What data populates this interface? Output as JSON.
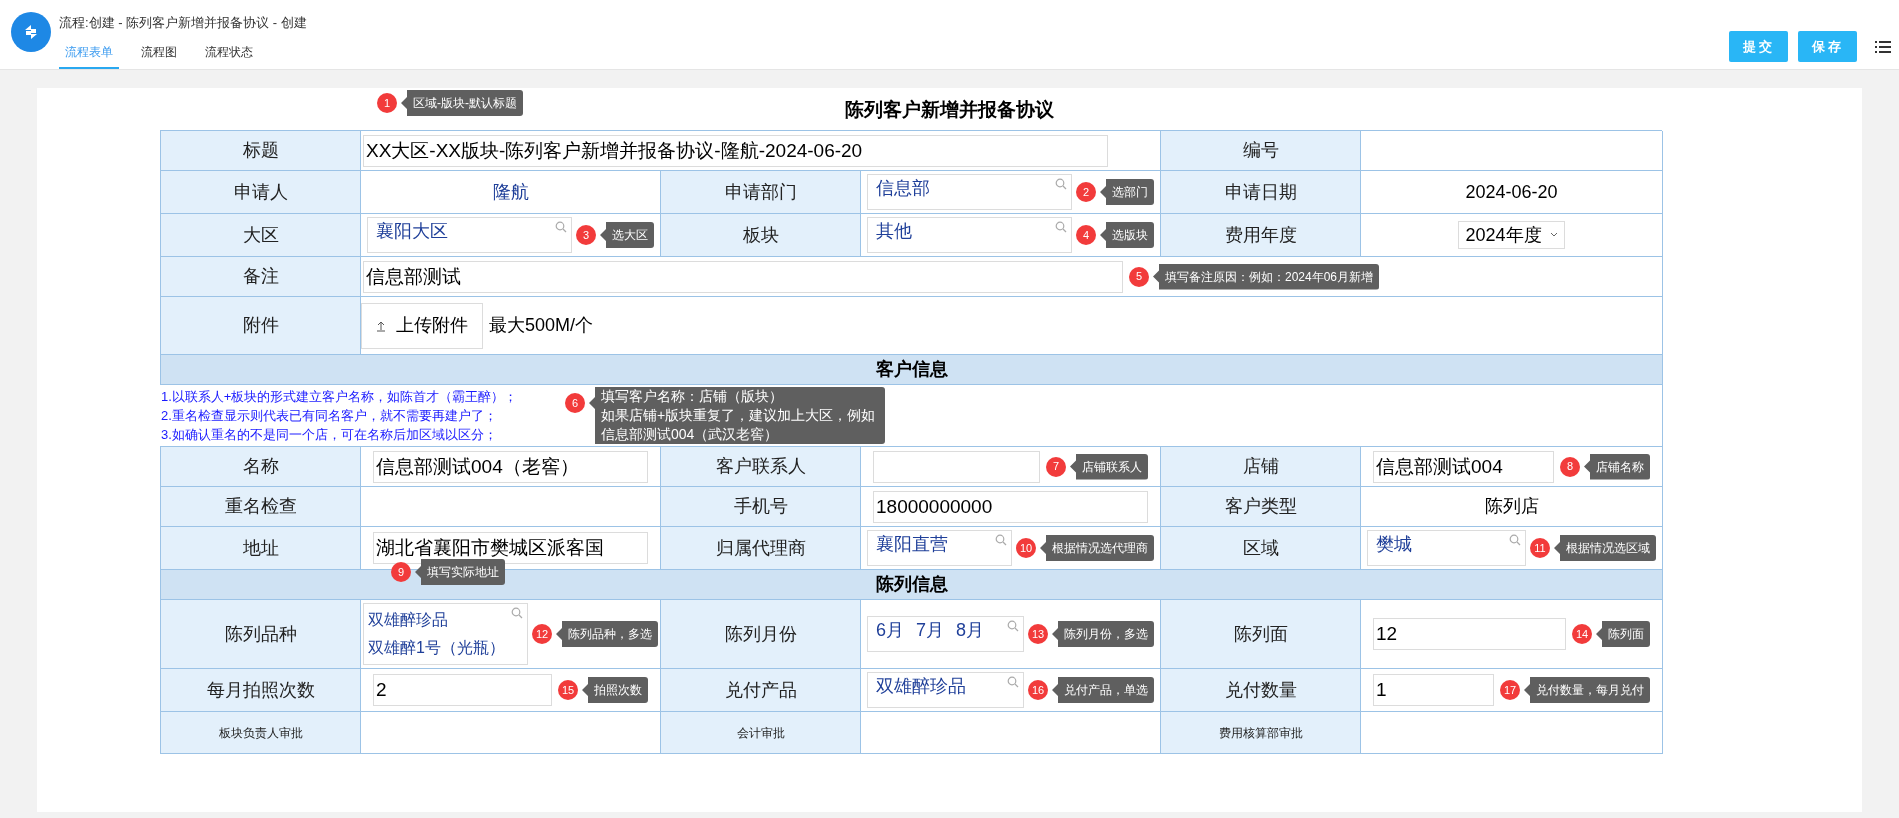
{
  "header": {
    "title": "流程:创建 - 陈列客户新增并报备协议 - 创建",
    "tabs": [
      {
        "label": "流程表单",
        "selected": true
      },
      {
        "label": "流程图",
        "selected": false
      },
      {
        "label": "流程状态",
        "selected": false
      }
    ],
    "buttons": [
      "提交",
      "保存"
    ]
  },
  "form": {
    "title": "陈列客户新增并报备协议",
    "title_hint": {
      "number": "1",
      "text": "区域-版块-默认标题"
    },
    "rows": [
      {
        "kind": "fields",
        "cells": [
          {
            "kind": "label",
            "text": "标题"
          },
          {
            "kind": "input",
            "colspan": 3,
            "value": "XX大区-XX版块-陈列客户新增并报备协议-隆航-2024-06-20"
          },
          {
            "kind": "label",
            "text": "编号"
          },
          {
            "kind": "empty"
          }
        ]
      },
      {
        "kind": "fields",
        "cells": [
          {
            "kind": "label",
            "text": "申请人"
          },
          {
            "kind": "user",
            "text": "隆航"
          },
          {
            "kind": "label",
            "text": "申请部门"
          },
          {
            "kind": "lookup",
            "values": [
              "信息部"
            ],
            "hint": {
              "number": "2",
              "text": "选部门"
            }
          },
          {
            "kind": "label",
            "text": "申请日期"
          },
          {
            "kind": "text",
            "text": "2024-06-20"
          }
        ]
      },
      {
        "kind": "fields",
        "cells": [
          {
            "kind": "label",
            "text": "大区"
          },
          {
            "kind": "lookup",
            "values": [
              "襄阳大区"
            ],
            "hint": {
              "number": "3",
              "text": "选大区"
            }
          },
          {
            "kind": "label",
            "text": "板块"
          },
          {
            "kind": "lookup",
            "values": [
              "其他"
            ],
            "hint": {
              "number": "4",
              "text": "选版块"
            }
          },
          {
            "kind": "label",
            "text": "费用年度"
          },
          {
            "kind": "select",
            "value": "2024年度"
          }
        ]
      },
      {
        "kind": "fields",
        "cells": [
          {
            "kind": "label",
            "text": "备注"
          },
          {
            "kind": "input",
            "colspan": 5,
            "value": "信息部测试",
            "hint": {
              "number": "5",
              "text": "填写备注原因：例如：2024年06月新增"
            }
          }
        ]
      },
      {
        "kind": "fields",
        "cells": [
          {
            "kind": "label",
            "text": "附件"
          },
          {
            "kind": "upload",
            "colspan": 5,
            "button": "上传附件",
            "note": "最大500M/个"
          }
        ]
      },
      {
        "kind": "section",
        "title": "客户信息"
      },
      {
        "kind": "notes",
        "lines": [
          "1.以联系人+板块的形式建立客户名称，如陈首才（霸王醉）；",
          "2.重名检查显示则代表已有同名客户，就不需要再建户了；",
          "3.如确认重名的不是同一个店，可在名称后加区域以区分；"
        ],
        "hint": {
          "number": "6",
          "lines": [
            "填写客户名称：店铺（版块）",
            "如果店铺+版块重复了，建议加上大区，例如",
            "信息部测试004（武汉老窖）"
          ]
        }
      },
      {
        "kind": "fields",
        "cells": [
          {
            "kind": "label",
            "text": "名称"
          },
          {
            "kind": "input",
            "value": "信息部测试004（老窖）"
          },
          {
            "kind": "label",
            "text": "客户联系人"
          },
          {
            "kind": "input",
            "hint": {
              "number": "7",
              "text": "店铺联系人"
            }
          },
          {
            "kind": "label",
            "text": "店铺"
          },
          {
            "kind": "input",
            "value": "信息部测试004",
            "hint": {
              "number": "8",
              "text": "店铺名称"
            }
          }
        ]
      },
      {
        "kind": "fields",
        "cells": [
          {
            "kind": "label",
            "text": "重名检查"
          },
          {
            "kind": "empty"
          },
          {
            "kind": "label",
            "text": "手机号"
          },
          {
            "kind": "input",
            "value": "18000000000"
          },
          {
            "kind": "label",
            "text": "客户类型"
          },
          {
            "kind": "text",
            "text": "陈列店"
          }
        ]
      },
      {
        "kind": "fields",
        "cells": [
          {
            "kind": "label",
            "text": "地址"
          },
          {
            "kind": "input",
            "value": "湖北省襄阳市樊城区派客国",
            "hint": {
              "number": "9",
              "text": "填写实际地址"
            }
          },
          {
            "kind": "label",
            "text": "归属代理商"
          },
          {
            "kind": "lookup",
            "values": [
              "襄阳直营"
            ],
            "hint": {
              "number": "10",
              "text": "根据情况选代理商"
            }
          },
          {
            "kind": "label",
            "text": "区域"
          },
          {
            "kind": "lookup",
            "values": [
              "樊城"
            ],
            "hint": {
              "number": "11",
              "text": "根据情况选区域"
            }
          }
        ]
      },
      {
        "kind": "section",
        "title": "陈列信息"
      },
      {
        "kind": "fields",
        "cells": [
          {
            "kind": "label",
            "text": "陈列品种"
          },
          {
            "kind": "multilookup",
            "values": [
              "双雄醉珍品",
              "双雄醉1号（光瓶）"
            ],
            "hint": {
              "number": "12",
              "text": "陈列品种，多选"
            }
          },
          {
            "kind": "label",
            "text": "陈列月份"
          },
          {
            "kind": "lookup",
            "values": [
              "6月",
              "7月",
              "8月"
            ],
            "hint": {
              "number": "13",
              "text": "陈列月份，多选"
            }
          },
          {
            "kind": "label",
            "text": "陈列面"
          },
          {
            "kind": "input",
            "value": "12",
            "hint": {
              "number": "14",
              "text": "陈列面"
            }
          }
        ]
      },
      {
        "kind": "fields",
        "cells": [
          {
            "kind": "label",
            "text": "每月拍照次数"
          },
          {
            "kind": "input",
            "value": "2",
            "hint": {
              "number": "15",
              "text": "拍照次数"
            }
          },
          {
            "kind": "label",
            "text": "兑付产品"
          },
          {
            "kind": "lookup",
            "values": [
              "双雄醉珍品"
            ],
            "hint": {
              "number": "16",
              "text": "兑付产品，单选"
            }
          },
          {
            "kind": "label",
            "text": "兑付数量"
          },
          {
            "kind": "input",
            "value": "1",
            "hint": {
              "number": "17",
              "text": "兑付数量，每月兑付"
            }
          }
        ]
      },
      {
        "kind": "fields",
        "cells": [
          {
            "kind": "approval",
            "text": "板块负责人审批"
          },
          {
            "kind": "empty"
          },
          {
            "kind": "approval",
            "text": "会计审批"
          },
          {
            "kind": "empty"
          },
          {
            "kind": "approval",
            "text": "费用核算部审批"
          },
          {
            "kind": "empty"
          }
        ]
      }
    ]
  }
}
